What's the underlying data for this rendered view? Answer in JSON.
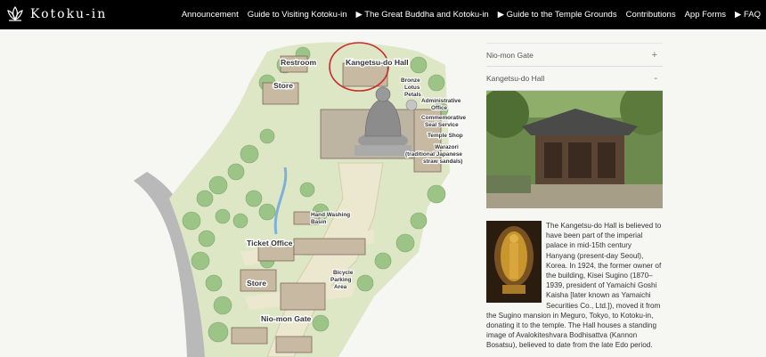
{
  "header": {
    "brand": "Kotoku-in",
    "nav": [
      "Announcement",
      "Guide to Visiting Kotoku-in",
      "▶ The Great Buddha and Kotoku-in",
      "▶ Guide to the Temple Grounds",
      "Contributions",
      "App Forms",
      "▶ FAQ"
    ]
  },
  "map": {
    "labels": {
      "restroom": "Restroom",
      "kangetsu": "Kangetsu-do Hall",
      "store_top": "Store",
      "bronze": [
        "Bronze",
        "Lotus",
        "Petals"
      ],
      "admin": [
        "Administrative",
        "Office"
      ],
      "commem": [
        "Commemorative",
        "Seal Service"
      ],
      "temple_shop": "Temple Shop",
      "warazori": [
        "Warazori",
        "(traditional Japanese",
        "straw sandals)"
      ],
      "hand_washing": [
        "Hand Washing",
        "Basin"
      ],
      "ticket": "Ticket Office",
      "bicycle": [
        "Bicycle",
        "Parking",
        "Area"
      ],
      "store_bottom": "Store",
      "niomon": "Nio-mon Gate"
    }
  },
  "panel": {
    "accordion": [
      {
        "label": "Nio-mon Gate",
        "sign": "+"
      },
      {
        "label": "Kangetsu-do Hall",
        "sign": "-"
      }
    ],
    "description": "The Kangetsu-do Hall is believed to have been part of the imperial palace in mid-15th century Hanyang (present-day Seoul), Korea. In 1924, the former owner of the building, Kisei Sugino (1870–1939, president of Yamaichi Goshi Kaisha [later known as Yamaichi Securities Co., Ltd.]), moved it from the Sugino mansion in Meguro, Tokyo, to Kotoku-in, donating it to the temple. The Hall houses a standing image of Avalokiteshvara Bodhisattva (Kannon Bosatsu), believed to date from the late Edo period."
  },
  "colors": {
    "accent": "#c82a2a",
    "tree": "#9fc58a",
    "path": "#e9e6cc",
    "road": "#b7b7b7"
  }
}
